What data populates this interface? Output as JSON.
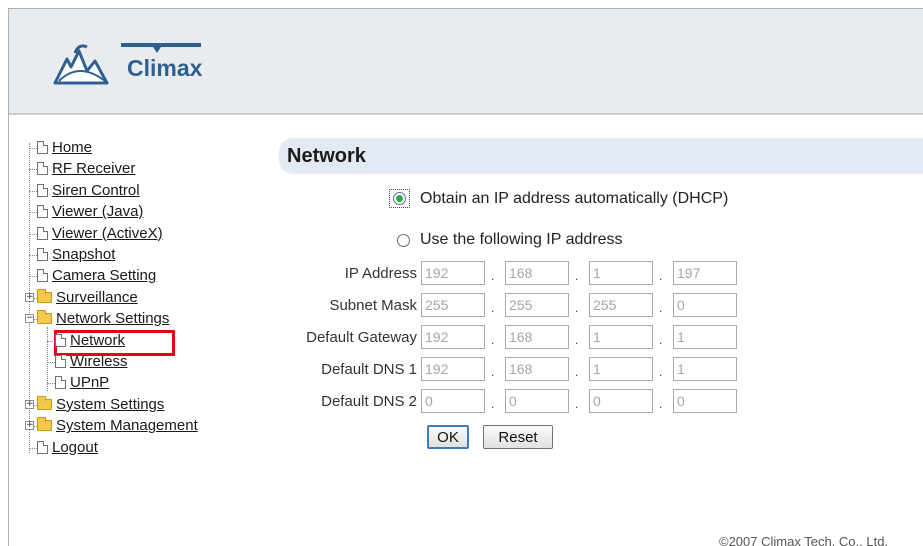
{
  "header": {
    "logo_text": "Climax"
  },
  "tree": {
    "items": [
      {
        "label": "Home",
        "type": "doc"
      },
      {
        "label": "RF Receiver",
        "type": "doc"
      },
      {
        "label": "Siren Control",
        "type": "doc"
      },
      {
        "label": "Viewer (Java)",
        "type": "doc"
      },
      {
        "label": "Viewer (ActiveX)",
        "type": "doc"
      },
      {
        "label": "Snapshot",
        "type": "doc"
      },
      {
        "label": "Camera Setting",
        "type": "doc"
      },
      {
        "label": "Surveillance",
        "type": "folder",
        "toggle": "+"
      },
      {
        "label": "Network Settings",
        "type": "folder-open",
        "toggle": "−"
      },
      {
        "label": "Network",
        "type": "doc",
        "child": true
      },
      {
        "label": "Wireless",
        "type": "doc",
        "child": true
      },
      {
        "label": "UPnP",
        "type": "doc",
        "child": true
      },
      {
        "label": "System Settings",
        "type": "folder",
        "toggle": "+"
      },
      {
        "label": "System Management",
        "type": "folder",
        "toggle": "+"
      },
      {
        "label": "Logout",
        "type": "doc"
      }
    ]
  },
  "main": {
    "title": "Network",
    "option_dhcp": "Obtain an IP address automatically (DHCP)",
    "option_static": "Use the following IP address",
    "selected_option": "dhcp",
    "fields": [
      {
        "label": "IP Address",
        "values": [
          "192",
          "168",
          "1",
          "197"
        ]
      },
      {
        "label": "Subnet Mask",
        "values": [
          "255",
          "255",
          "255",
          "0"
        ]
      },
      {
        "label": "Default Gateway",
        "values": [
          "192",
          "168",
          "1",
          "1"
        ]
      },
      {
        "label": "Default DNS 1",
        "values": [
          "192",
          "168",
          "1",
          "1"
        ]
      },
      {
        "label": "Default DNS 2",
        "values": [
          "0",
          "0",
          "0",
          "0"
        ]
      }
    ],
    "ok_label": "OK",
    "reset_label": "Reset"
  },
  "footer": {
    "copyright": "©2007 Climax Tech. Co., Ltd."
  },
  "colors": {
    "highlight": "#e60012",
    "title_bg": "#e3eaf3",
    "radio_selected": "#2fa944"
  }
}
